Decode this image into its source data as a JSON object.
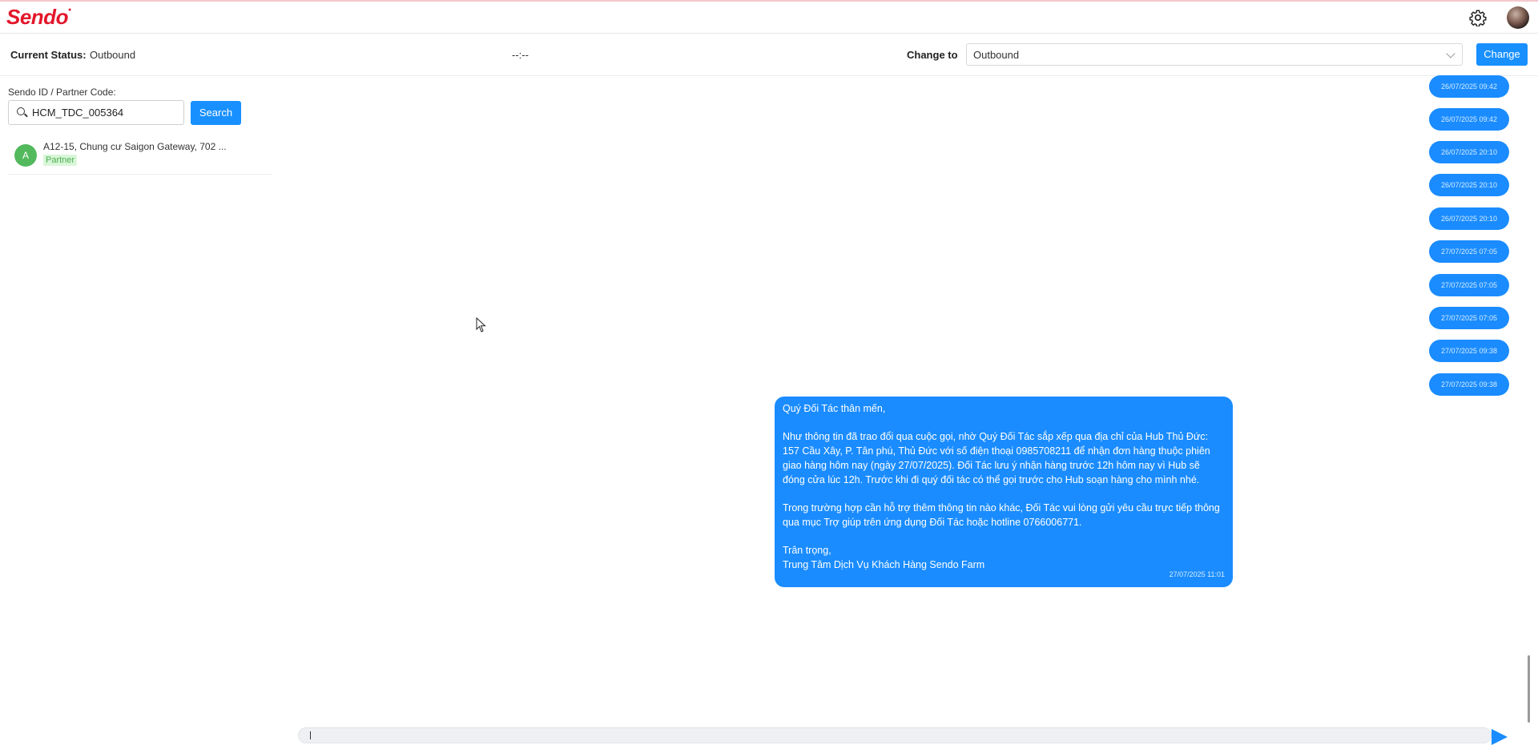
{
  "header": {
    "logo_text": "Sendo",
    "brand_color": "#e3172b",
    "icons": [
      "gear-icon",
      "user-avatar"
    ]
  },
  "status_bar": {
    "current_status_label": "Current Status:",
    "current_status_value": "Outbound",
    "timer": "--:--",
    "change_to_label": "Change to",
    "change_to_selected": "Outbound",
    "change_button": "Change",
    "accent_color": "#1890ff"
  },
  "sidebar": {
    "search_label": "Sendo ID / Partner Code:",
    "search_value": "HCM_TDC_005364",
    "search_button": "Search",
    "results": [
      {
        "avatar_letter": "A",
        "name": "A12-15, Chung cư Saigon Gateway, 702 ...",
        "tag": "Partner"
      }
    ]
  },
  "chat": {
    "timestamps": [
      "26/07/2025 09:42",
      "26/07/2025 09:42",
      "26/07/2025 20:10",
      "26/07/2025 20:10",
      "26/07/2025 20:10",
      "27/07/2025 07:05",
      "27/07/2025 07:05",
      "27/07/2025 07:05",
      "27/07/2025 09:38",
      "27/07/2025 09:38"
    ],
    "last_message": {
      "lines": [
        "Quý Đối Tác thân mến,",
        "",
        "Như thông tin đã trao đổi qua cuộc gọi, nhờ Quý Đối Tác sắp xếp qua địa chỉ của Hub Thủ Đức: 157 Cầu Xây, P. Tân phú, Thủ Đức với số điện thoại 0985708211 để nhận đơn hàng thuộc phiên giao hàng hôm nay (ngày 27/07/2025). Đối Tác lưu ý nhận hàng trước 12h hôm nay vì Hub sẽ đóng cửa lúc 12h. Trước khi đi quý đối tác có thể gọi trước cho Hub soạn hàng cho mình nhé.",
        "",
        "Trong trường hợp cần hỗ trợ thêm thông tin nào khác, Đối Tác vui lòng gửi yêu cầu trực tiếp thông qua mục Trợ giúp trên ứng dụng Đối Tác hoặc hotline 0766006771.",
        "",
        "Trân trọng,",
        "Trung Tâm Dịch Vụ Khách Hàng Sendo Farm"
      ],
      "time": "27/07/2025 11:01"
    },
    "bubble_color": "#1a8cff",
    "send_icon": "send-icon"
  }
}
